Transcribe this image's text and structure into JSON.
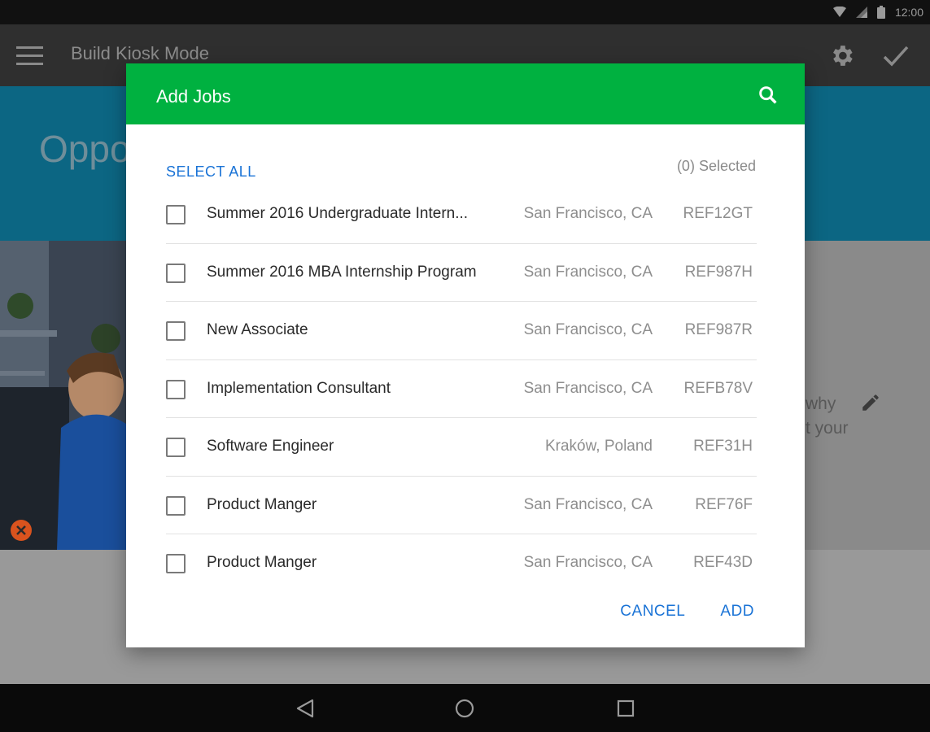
{
  "status_bar": {
    "time": "12:00",
    "icons": [
      "wifi-icon",
      "signal-icon",
      "battery-icon"
    ]
  },
  "app": {
    "title": "Build Kiosk Mode",
    "banner_title": "Oppo",
    "bg_text": "why\nt your",
    "toolbar_icons": [
      "menu-icon",
      "gear-icon",
      "check-icon"
    ]
  },
  "dialog": {
    "title": "Add Jobs",
    "select_all": "SELECT ALL",
    "selected_count": "(0) Selected",
    "jobs": [
      {
        "title": "Summer 2016 Undergraduate Intern...",
        "location": "San Francisco, CA",
        "ref": "REF12GT",
        "checked": false
      },
      {
        "title": "Summer 2016 MBA Internship Program",
        "location": "San Francisco, CA",
        "ref": "REF987H",
        "checked": false
      },
      {
        "title": "New Associate",
        "location": "San Francisco, CA",
        "ref": "REF987R",
        "checked": false
      },
      {
        "title": "Implementation Consultant",
        "location": "San Francisco, CA",
        "ref": "REFB78V",
        "checked": false
      },
      {
        "title": "Software Engineer",
        "location": "Kraków, Poland",
        "ref": "REF31H",
        "checked": false
      },
      {
        "title": "Product Manger",
        "location": "San Francisco, CA",
        "ref": "REF76F",
        "checked": false
      },
      {
        "title": "Product Manger",
        "location": "San Francisco, CA",
        "ref": "REF43D",
        "checked": false
      }
    ],
    "cancel_label": "CANCEL",
    "add_label": "ADD"
  },
  "colors": {
    "header": "#00b140",
    "accent": "#1a73d6",
    "toolbar": "#2f2f2f",
    "banner": "#0c6683",
    "remove": "#d9531e"
  },
  "nav": {
    "buttons": [
      "back-icon",
      "home-icon",
      "recents-icon"
    ]
  }
}
